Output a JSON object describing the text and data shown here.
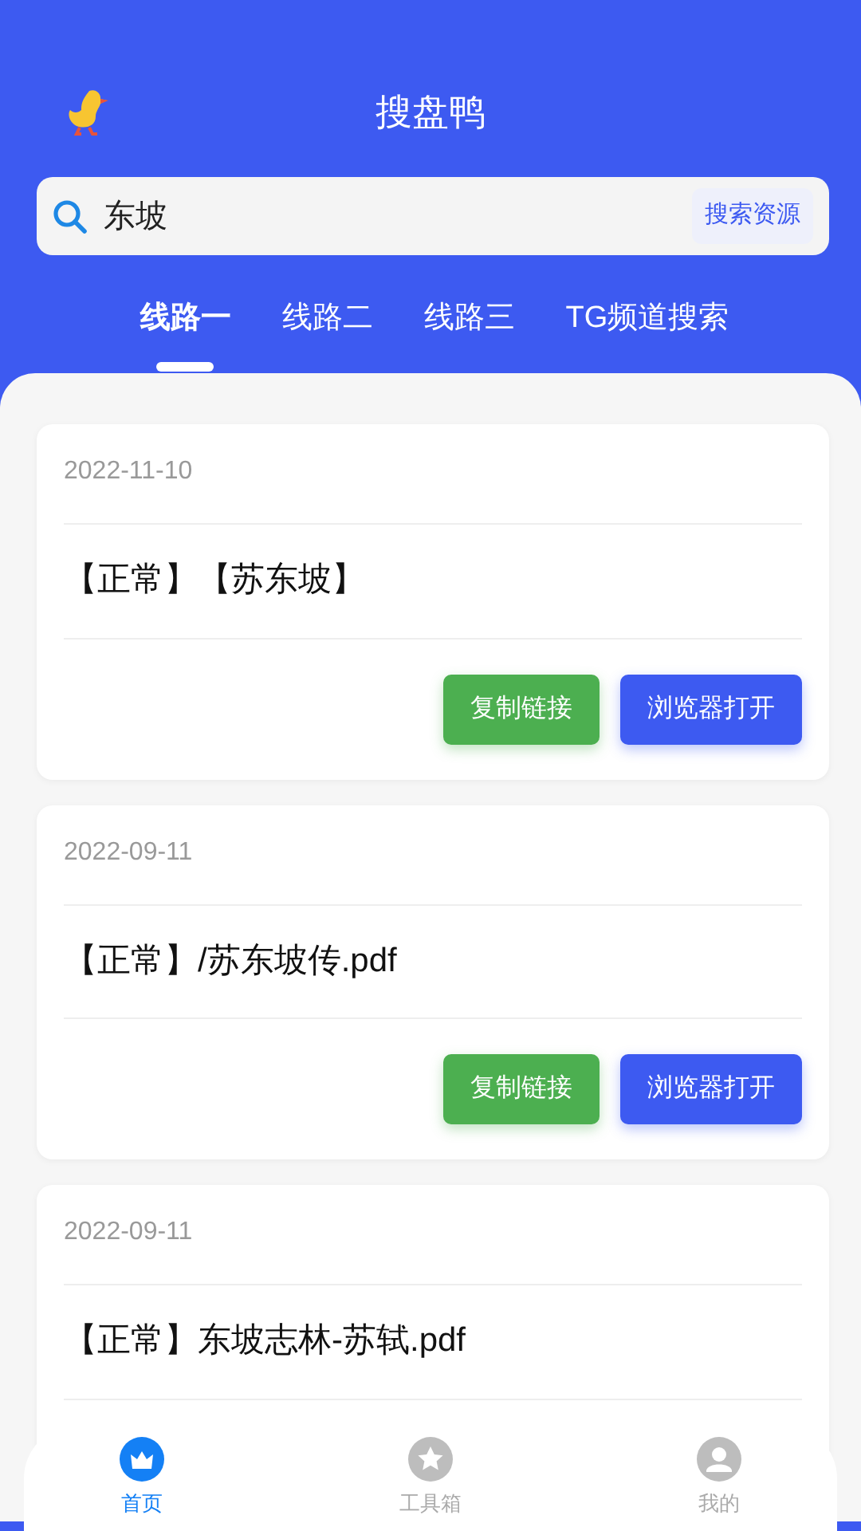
{
  "header": {
    "title": "搜盘鸭"
  },
  "search": {
    "value": "东坡",
    "button": "搜索资源"
  },
  "tabs": [
    {
      "label": "线路一",
      "selected": true
    },
    {
      "label": "线路二",
      "selected": false
    },
    {
      "label": "线路三",
      "selected": false
    },
    {
      "label": "TG频道搜索",
      "selected": false
    }
  ],
  "results": [
    {
      "date": "2022-11-10",
      "title": "【正常】【苏东坡】",
      "buttons": [
        {
          "label": "复制链接",
          "kind": "copy"
        },
        {
          "label": "浏览器打开",
          "kind": "open"
        }
      ]
    },
    {
      "date": "2022-09-11",
      "title": "【正常】/苏东坡传.pdf",
      "buttons": [
        {
          "label": "复制链接",
          "kind": "copy"
        },
        {
          "label": "浏览器打开",
          "kind": "open"
        }
      ]
    },
    {
      "date": "2022-09-11",
      "title": "【正常】东坡志林-苏轼.pdf"
    }
  ],
  "bottom_nav": [
    {
      "label": "首页",
      "kind": "home",
      "selected": true
    },
    {
      "label": "工具箱",
      "kind": "tools",
      "selected": false
    },
    {
      "label": "我的",
      "kind": "profile",
      "selected": false
    }
  ]
}
